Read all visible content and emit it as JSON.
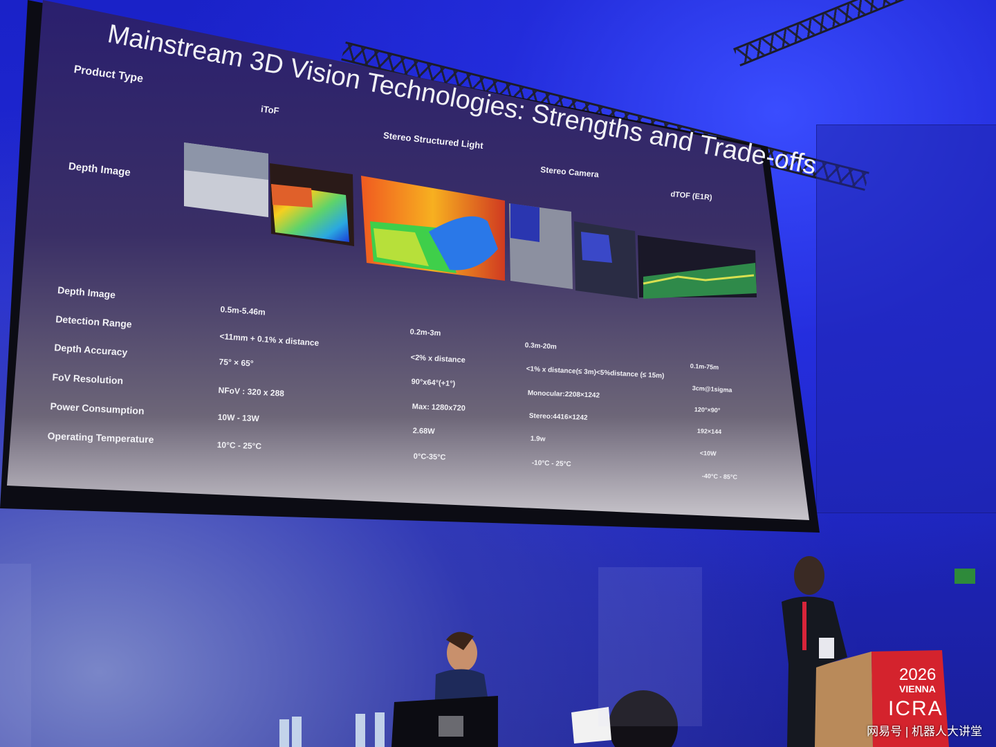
{
  "slide": {
    "title": "Mainstream 3D Vision Technologies: Strengths and Trade-offs",
    "product_type_label": "Product Type",
    "columns": [
      "iToF",
      "Stereo Structured Light",
      "Stereo Camera",
      "dTOF (E1R)"
    ],
    "depth_image_label": "Depth Image",
    "row_labels": [
      "Depth Image",
      "Detection Range",
      "Depth Accuracy",
      "FoV Resolution",
      "Power Consumption",
      "Operating Temperature"
    ],
    "itof": [
      "0.5m-5.46m",
      "<11mm + 0.1% x distance",
      "75° × 65°",
      "NFoV : 320 x 288",
      "10W - 13W",
      "10°C - 25°C"
    ],
    "structured_light": [
      "0.2m-3m",
      "<2% x distance",
      "90°x64°(+1°)",
      "Max: 1280x720",
      "2.68W",
      "0°C-35°C"
    ],
    "stereo_camera": [
      "0.3m-20m",
      "<1% x distance(≤ 3m)<5%distance (≤ 15m)",
      "Monocular:2208×1242",
      "Stereo:4416×1242",
      "1.9w",
      "-10°C - 25°C"
    ],
    "dtof": [
      "0.1m-75m",
      "3cm@1sigma",
      "120°×90°",
      "192×144",
      "<10W",
      "-40°C - 85°C"
    ]
  },
  "podium": {
    "year": "2026",
    "city": "VIENNA",
    "conference": "ICRA"
  },
  "watermark": "网易号 | 机器人大讲堂"
}
